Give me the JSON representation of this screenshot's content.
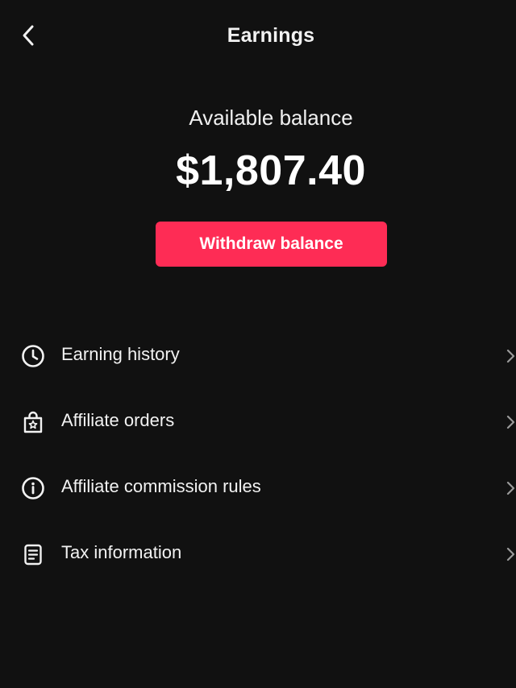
{
  "header": {
    "back_icon": "chevron-left-icon",
    "title": "Earnings"
  },
  "balance": {
    "label": "Available balance",
    "amount": "$1,807.40"
  },
  "withdraw_button": {
    "label": "Withdraw balance",
    "color": "#fe2c55"
  },
  "menu": {
    "items": [
      {
        "label": "Earning history",
        "icon": "clock-icon"
      },
      {
        "label": "Affiliate orders",
        "icon": "shopping-bag-icon"
      },
      {
        "label": "Affiliate commission rules",
        "icon": "info-icon"
      },
      {
        "label": "Tax information",
        "icon": "document-icon"
      }
    ]
  },
  "colors": {
    "background": "#111111",
    "text": "#f2f2f2",
    "accent": "#fe2c55"
  }
}
